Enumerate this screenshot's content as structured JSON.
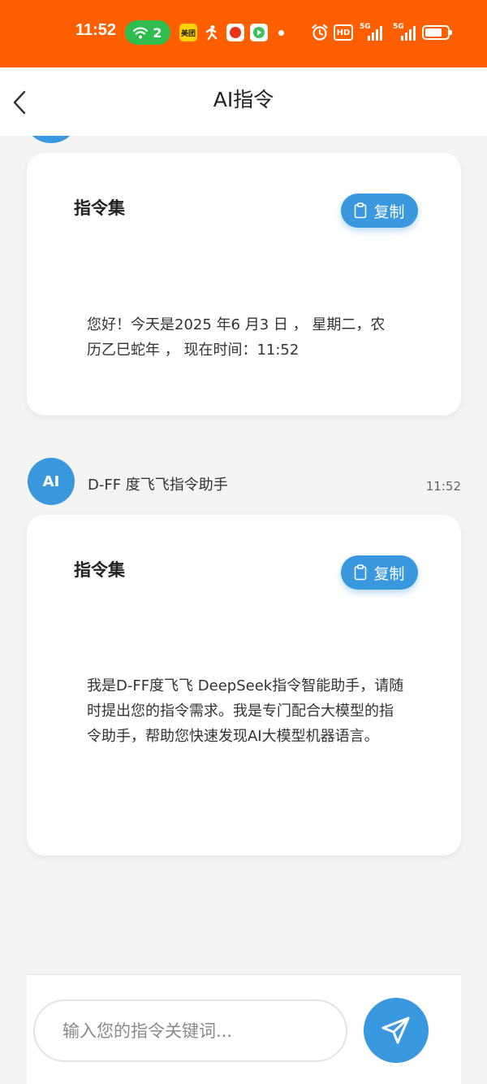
{
  "status_bar": {
    "time": "11:52",
    "wifi_count": "2",
    "hd_label": "HD",
    "signal_1": "5G",
    "signal_2": "5G",
    "bg_color": "#ff5f00",
    "app_icons": [
      "meituan-icon",
      "running-person-icon",
      "shopping-app-icon",
      "video-app-icon"
    ],
    "meituan_label": "美团"
  },
  "nav": {
    "title": "AI指令"
  },
  "messages": [
    {
      "card_title": "指令集",
      "copy_label": "复制",
      "text": "您好！今天是2025 年6 月3 日 ， 星期二，农历乙巳蛇年 ， 现在时间：11:52"
    },
    {
      "avatar_text": "AI",
      "sender": "D-FF 度飞飞指令助手",
      "time": "11:52",
      "card_title": "指令集",
      "copy_label": "复制",
      "text": "我是D-FF度飞飞 DeepSeek指令智能助手，请随时提出您的指令需求。我是专门配合大模型的指令助手，帮助您快速发现AI大模型机器语言。"
    }
  ],
  "input": {
    "placeholder": "输入您的指令关键词..."
  },
  "colors": {
    "accent": "#3a98de",
    "background": "#f4f4f4"
  }
}
